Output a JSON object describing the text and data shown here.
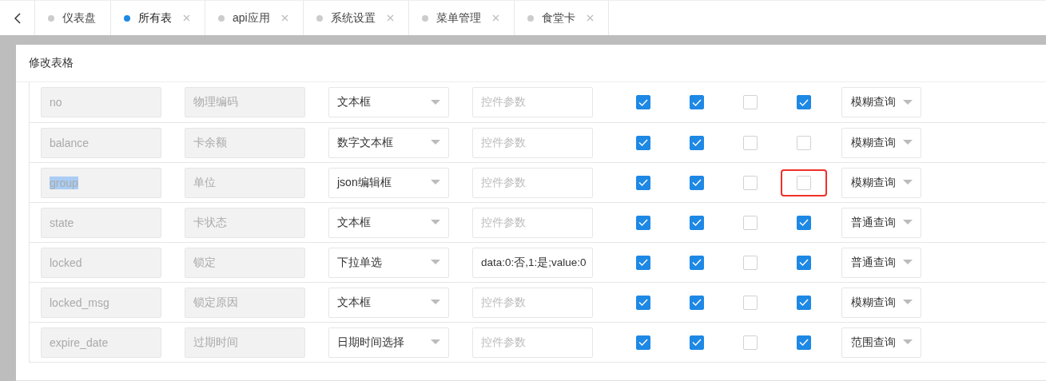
{
  "tabs": [
    {
      "label": "仪表盘",
      "selected": false,
      "closable": false
    },
    {
      "label": "所有表",
      "selected": true,
      "closable": true
    },
    {
      "label": "api应用",
      "selected": false,
      "closable": true
    },
    {
      "label": "系统设置",
      "selected": false,
      "closable": true
    },
    {
      "label": "菜单管理",
      "selected": false,
      "closable": true
    },
    {
      "label": "食堂卡",
      "selected": false,
      "closable": true
    }
  ],
  "dialog": {
    "title": "修改表格"
  },
  "rows": [
    {
      "field": "no",
      "field_selected": false,
      "label": "物理编码",
      "control": "文本框",
      "params": {
        "placeholder": "控件参数"
      },
      "checks": [
        {
          "checked": true,
          "highlighted": false
        },
        {
          "checked": true,
          "highlighted": false
        },
        {
          "checked": false,
          "highlighted": false
        },
        {
          "checked": true,
          "highlighted": false
        }
      ],
      "query": "模糊查询"
    },
    {
      "field": "balance",
      "field_selected": false,
      "label": "卡余额",
      "control": "数字文本框",
      "params": {
        "placeholder": "控件参数"
      },
      "checks": [
        {
          "checked": true,
          "highlighted": false
        },
        {
          "checked": true,
          "highlighted": false
        },
        {
          "checked": false,
          "highlighted": false
        },
        {
          "checked": false,
          "highlighted": false
        }
      ],
      "query": "模糊查询"
    },
    {
      "field": "group",
      "field_selected": true,
      "label": "单位",
      "control": "json编辑框",
      "params": {
        "placeholder": "控件参数"
      },
      "checks": [
        {
          "checked": true,
          "highlighted": false
        },
        {
          "checked": true,
          "highlighted": false
        },
        {
          "checked": false,
          "highlighted": false
        },
        {
          "checked": false,
          "highlighted": true
        }
      ],
      "query": "模糊查询"
    },
    {
      "field": "state",
      "field_selected": false,
      "label": "卡状态",
      "control": "文本框",
      "params": {
        "placeholder": "控件参数"
      },
      "checks": [
        {
          "checked": true,
          "highlighted": false
        },
        {
          "checked": true,
          "highlighted": false
        },
        {
          "checked": false,
          "highlighted": false
        },
        {
          "checked": true,
          "highlighted": false
        }
      ],
      "query": "普通查询"
    },
    {
      "field": "locked",
      "field_selected": false,
      "label": "锁定",
      "control": "下拉单选",
      "params": {
        "value": "data:0:否,1:是;value:0"
      },
      "checks": [
        {
          "checked": true,
          "highlighted": false
        },
        {
          "checked": true,
          "highlighted": false
        },
        {
          "checked": false,
          "highlighted": false
        },
        {
          "checked": true,
          "highlighted": false
        }
      ],
      "query": "普通查询"
    },
    {
      "field": "locked_msg",
      "field_selected": false,
      "label": "锁定原因",
      "control": "文本框",
      "params": {
        "placeholder": "控件参数"
      },
      "checks": [
        {
          "checked": true,
          "highlighted": false
        },
        {
          "checked": true,
          "highlighted": false
        },
        {
          "checked": false,
          "highlighted": false
        },
        {
          "checked": true,
          "highlighted": false
        }
      ],
      "query": "模糊查询"
    },
    {
      "field": "expire_date",
      "field_selected": false,
      "label": "过期时间",
      "control": "日期时间选择",
      "params": {
        "placeholder": "控件参数"
      },
      "checks": [
        {
          "checked": true,
          "highlighted": false
        },
        {
          "checked": true,
          "highlighted": false
        },
        {
          "checked": false,
          "highlighted": false
        },
        {
          "checked": true,
          "highlighted": false
        }
      ],
      "query": "范围查询"
    }
  ]
}
